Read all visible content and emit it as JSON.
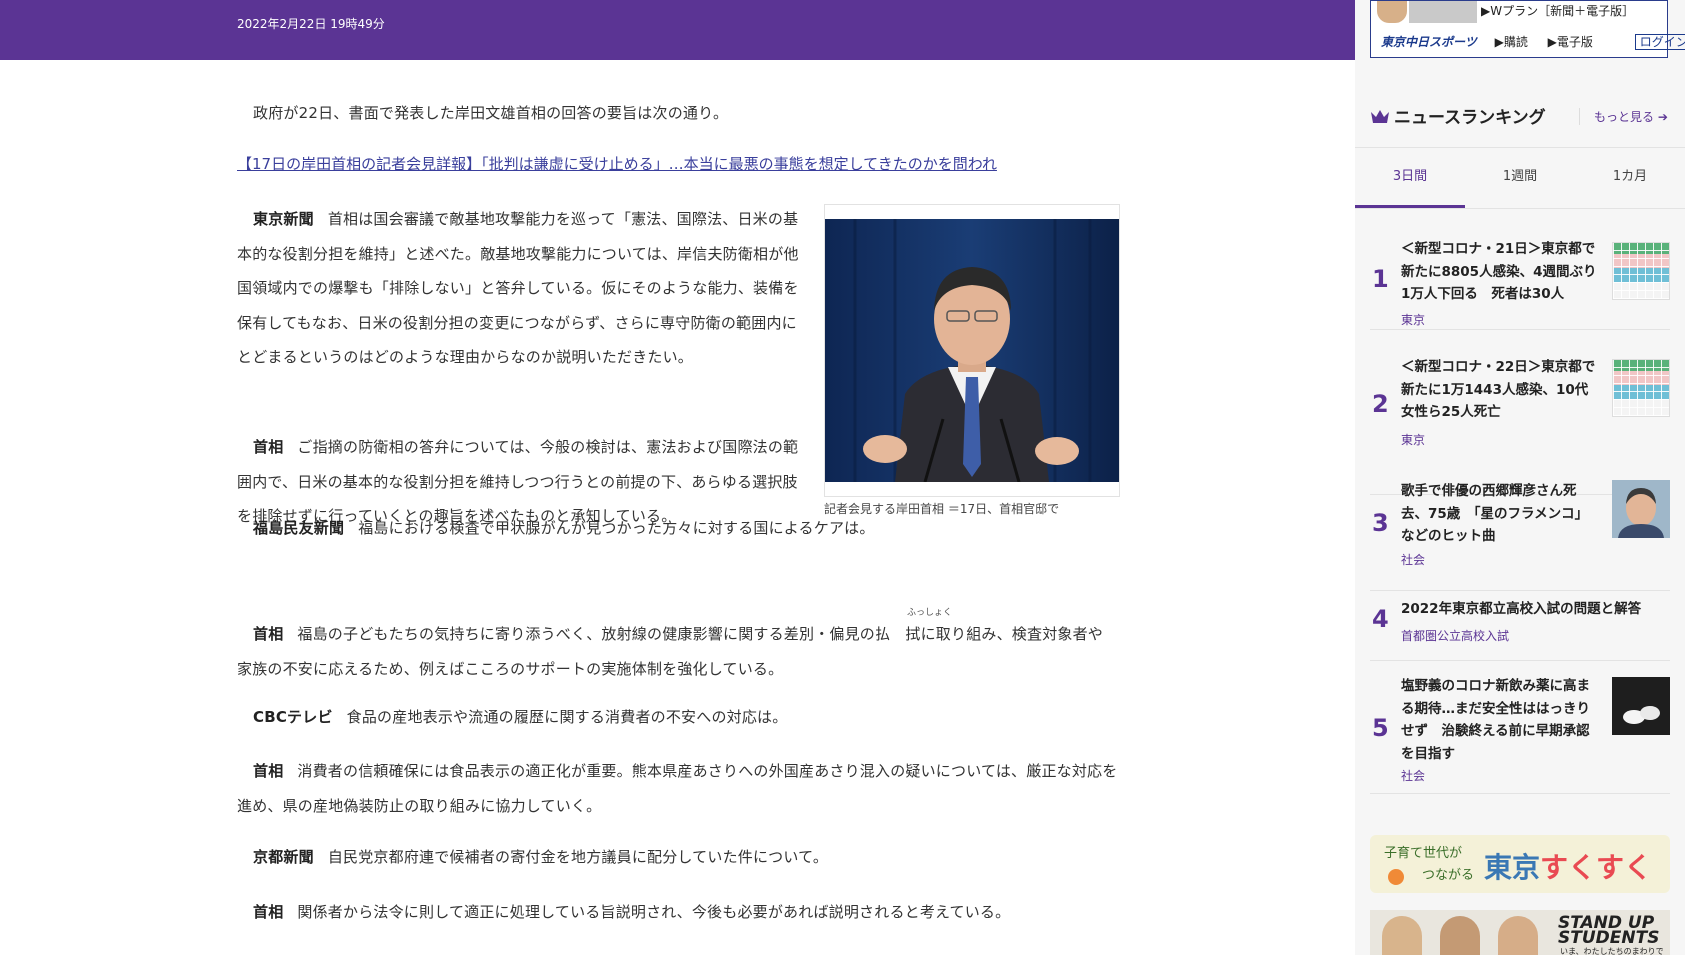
{
  "header": {
    "date": "2022年2月22日 19時49分"
  },
  "article": {
    "intro": "政府が22日、書面で発表した岸田文雄首相の回答の要旨は次の通り。",
    "related_link": "【17日の岸田首相の記者会見詳報】「批判は謙虚に受け止める」…本当に最悪の事態を想定してきたのかを問われ",
    "photo_caption": "記者会見する岸田首相 ＝17日、首相官邸で",
    "ruby": "ふっしょく",
    "qa": [
      {
        "speaker": "東京新聞",
        "text": "首相は国会審議で敵基地攻撃能力を巡って「憲法、国際法、日米の基本的な役割分担を維持」と述べた。敵基地攻撃能力については、岸信夫防衛相が他国領域内での爆撃も「排除しない」と答弁している。仮にそのような能力、装備を保有してもなお、日米の役割分担の変更につながらず、さらに専守防衛の範囲内にとどまるというのはどのような理由からなのか説明いただきたい。"
      },
      {
        "speaker": "首相",
        "text": "ご指摘の防衛相の答弁については、今般の検討は、憲法および国際法の範囲内で、日米の基本的な役割分担を維持しつつ行うとの前提の下、あらゆる選択肢を排除せずに行っていくとの趣旨を述べたものと承知している。"
      },
      {
        "speaker": "福島民友新聞",
        "text": "福島における検査で甲状腺がんが見つかった方々に対する国によるケアは。"
      },
      {
        "speaker": "首相",
        "text": "福島の子どもたちの気持ちに寄り添うべく、放射線の健康影響に関する差別・偏見の払　拭に取り組み、検査対象者や家族の不安に応えるため、例えばこころのサポートの実施体制を強化している。"
      },
      {
        "speaker": "CBCテレビ",
        "text": "食品の産地表示や流通の履歴に関する消費者の不安への対応は。"
      },
      {
        "speaker": "首相",
        "text": "消費者の信頼確保には食品表示の適正化が重要。熊本県産あさりへの外国産あさり混入の疑いについては、厳正な対応を進め、県の産地偽装防止の取り組みに協力していく。"
      },
      {
        "speaker": "京都新聞",
        "text": "自民党京都府連で候補者の寄付金を地方議員に配分していた件について。"
      },
      {
        "speaker": "首相",
        "text": "関係者から法令に則して適正に処理している旨説明され、今後も必要があれば説明されると考えている。"
      }
    ]
  },
  "sidebar": {
    "ad": {
      "plan": "▶Wプラン［新聞＋電子版］",
      "logo": "東京中日スポーツ",
      "subscribe": "▶購読",
      "digital": "▶電子版",
      "login": "ログイン"
    },
    "ranking": {
      "title": "ニュースランキング",
      "more": "もっと見る ➔",
      "tabs": [
        "3日間",
        "1週間",
        "1カ月"
      ],
      "items": [
        {
          "rank": "1",
          "title": "＜新型コロナ・21日＞東京都で新たに8805人感染、4週間ぶり1万人下回る　死者は30人",
          "category": "東京"
        },
        {
          "rank": "2",
          "title": "＜新型コロナ・22日＞東京都で新たに1万1443人感染、10代女性ら25人死亡",
          "category": "東京"
        },
        {
          "rank": "3",
          "title": "歌手で俳優の西郷輝彦さん死去、75歳　「星のフラメンコ」などのヒット曲",
          "category": "社会"
        },
        {
          "rank": "4",
          "title": "2022年東京都立高校入試の問題と解答",
          "category": "首都圏公立高校入試"
        },
        {
          "rank": "5",
          "title": "塩野義のコロナ新飲み薬に高まる期待…まだ安全性ははっきりせず　治験終える前に早期承認を目指す",
          "category": "社会"
        }
      ]
    },
    "banner1": {
      "line1": "子育て世代が",
      "line2": "つながる",
      "tokyo": "東京",
      "sukusuku": "すくすく"
    },
    "banner2": {
      "title1": "STAND UP",
      "title2": "STUDENTS",
      "sub": "いま、わたしたちのまわりで"
    }
  },
  "colors": {
    "brand": "#5b3494",
    "link": "#3a3f9c"
  }
}
